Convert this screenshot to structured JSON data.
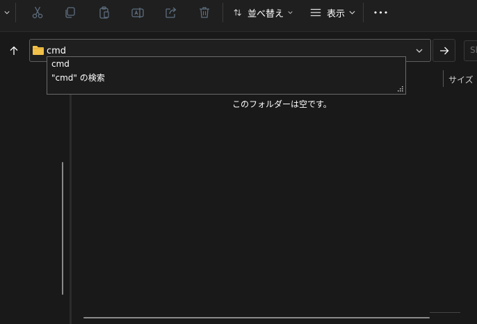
{
  "toolbar": {
    "icons": [
      "chevron-down-icon",
      "cut-icon",
      "copy-icon",
      "paste-icon",
      "rename-icon",
      "share-icon",
      "delete-icon"
    ],
    "sort_label": "並べ替え",
    "view_label": "表示",
    "more_label": "•••"
  },
  "address": {
    "value": "cmd",
    "folder_icon": "folder-icon"
  },
  "search_box": {
    "partial_text": "Sl"
  },
  "suggestions": [
    "cmd",
    "\"cmd\" の検索"
  ],
  "columns": {
    "size": "サイズ"
  },
  "content": {
    "empty_message": "このフォルダーは空です。"
  },
  "colors": {
    "background": "#191919",
    "toolbar": "#1f1f1f",
    "folder": "#f2c14a",
    "icon_disabled": "#5a6a7a"
  }
}
